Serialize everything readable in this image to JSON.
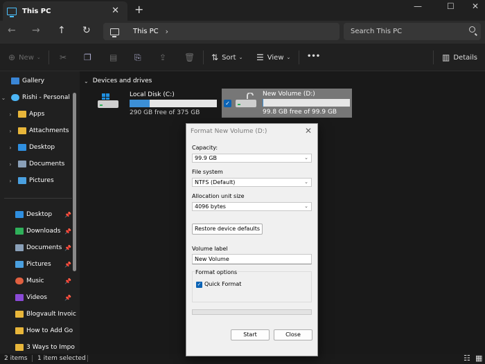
{
  "window": {
    "tab_title": "This PC",
    "new_tab": "+",
    "tab_close": "✕"
  },
  "nav": {
    "breadcrumb": "This PC",
    "breadcrumb_chevron": "›",
    "search_placeholder": "Search This PC"
  },
  "toolbar": {
    "new_label": "New",
    "sort_label": "Sort",
    "view_label": "View",
    "more_label": "•••",
    "details_label": "Details"
  },
  "sidebar": {
    "items": [
      {
        "label": "Gallery",
        "color": "#3a86d6"
      },
      {
        "label": "Rishi - Personal",
        "color": "#4cb5f5"
      },
      {
        "label": "Apps",
        "color": "#e8b63a"
      },
      {
        "label": "Attachments",
        "color": "#e8b63a"
      },
      {
        "label": "Desktop",
        "color": "#2f8fe0"
      },
      {
        "label": "Documents",
        "color": "#8aa0b8"
      },
      {
        "label": "Pictures",
        "color": "#4aa0e0"
      }
    ],
    "quick": [
      {
        "label": "Desktop",
        "color": "#2f8fe0"
      },
      {
        "label": "Downloads",
        "color": "#2fb05a"
      },
      {
        "label": "Documents",
        "color": "#8aa0b8"
      },
      {
        "label": "Pictures",
        "color": "#4aa0e0"
      },
      {
        "label": "Music",
        "color": "#e06040"
      },
      {
        "label": "Videos",
        "color": "#8a4ad6"
      },
      {
        "label": "Blogvault Invoic",
        "color": "#e8b63a"
      },
      {
        "label": "How to Add Go",
        "color": "#e8b63a"
      },
      {
        "label": "3 Ways to Impo",
        "color": "#e8b63a"
      }
    ]
  },
  "content": {
    "section_title": "Devices and drives",
    "drives": [
      {
        "name": "Local Disk (C:)",
        "free": "290 GB free of 375 GB",
        "used": 0.23
      },
      {
        "name": "New Volume (D:)",
        "free": "99.8 GB free of 99.9 GB",
        "used": 0.001
      }
    ]
  },
  "status": {
    "items": "2 items",
    "selected": "1 item selected"
  },
  "dialog": {
    "title": "Format New Volume (D:)",
    "capacity_label": "Capacity:",
    "capacity_value": "99.9 GB",
    "fs_label": "File system",
    "fs_value": "NTFS (Default)",
    "alloc_label": "Allocation unit size",
    "alloc_value": "4096 bytes",
    "restore_label": "Restore device defaults",
    "volume_label": "Volume label",
    "volume_value": "New Volume",
    "options_label": "Format options",
    "quick_label": "Quick Format",
    "start_label": "Start",
    "close_label": "Close",
    "progress": 0
  }
}
